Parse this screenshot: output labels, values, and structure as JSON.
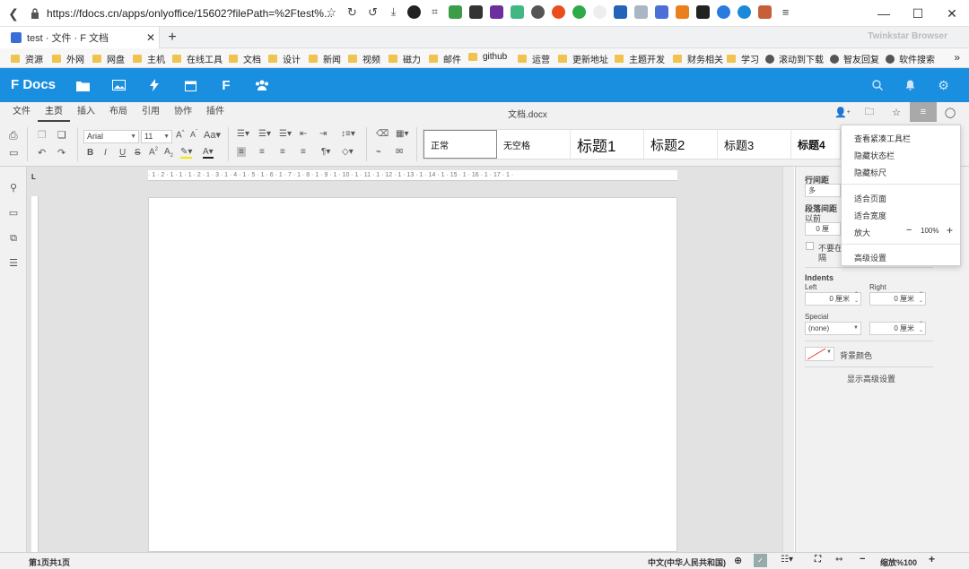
{
  "browser": {
    "url": "https://fdocs.cn/apps/onlyoffice/15602?filePath=%2Ftest%...",
    "tab_title": "test · 文件 · F 文档",
    "brand": "Twinkstar Browser",
    "bookmarks": [
      "资源",
      "外网",
      "网盘",
      "主机",
      "在线工具",
      "文档",
      "设计",
      "新闻",
      "视频",
      "磁力",
      "邮件",
      "github",
      "运营",
      "更新地址",
      "主题开发",
      "财务相关",
      "学习",
      "滚动到下载",
      "智友回复",
      "软件搜索"
    ]
  },
  "app": {
    "logo": "F Docs"
  },
  "menubar": {
    "items": [
      "文件",
      "主页",
      "插入",
      "布局",
      "引用",
      "协作",
      "插件"
    ],
    "active": "主页",
    "doc_name": "文档.docx"
  },
  "toolbar": {
    "font_name": "Arial",
    "font_size": "11",
    "styles": [
      "正常",
      "无空格",
      "标题1",
      "标题2",
      "标题3",
      "标题4"
    ]
  },
  "ruler": {
    "marks": "· 1 · 2 · 1 · 1 · 1 · 2 · 1 · 3 · 1 · 4 · 1 · 5 · 1 · 6 · 1 · 7 · 1 · 8 · 1 · 9 · 1 · 10 · 1 · 11 · 1 · 12 · 1 · 13 · 1 · 14 · 1 · 15 · 1 · 16 · 1 · 17 · 1 ·"
  },
  "right_panel": {
    "line_spacing_label": "行间距",
    "line_spacing_value": "多",
    "paragraph_spacing_label": "段落间距",
    "before_label": "以前",
    "before_value": "0 厘",
    "checkbox_label_line1": "不要在",
    "checkbox_label_line2": "隔",
    "indents_label": "Indents",
    "left_label": "Left",
    "right_label": "Right",
    "left_value": "0 厘米",
    "right_value": "0 厘米",
    "special_label": "Special",
    "special_value": "(none)",
    "special_amount": "0 厘米",
    "bg_color_label": "背景颜色",
    "advanced_link": "显示高级设置"
  },
  "dropdown": {
    "items": [
      "查看紧凑工具栏",
      "隐藏状态栏",
      "隐藏标尺"
    ],
    "fit_page": "适合页面",
    "fit_width": "适合宽度",
    "zoom_label": "放大",
    "zoom_value": "100%",
    "advanced": "高级设置"
  },
  "status": {
    "page_info": "第1页共1页",
    "language": "中文(中华人民共和国)",
    "zoom": "缩放%100"
  }
}
